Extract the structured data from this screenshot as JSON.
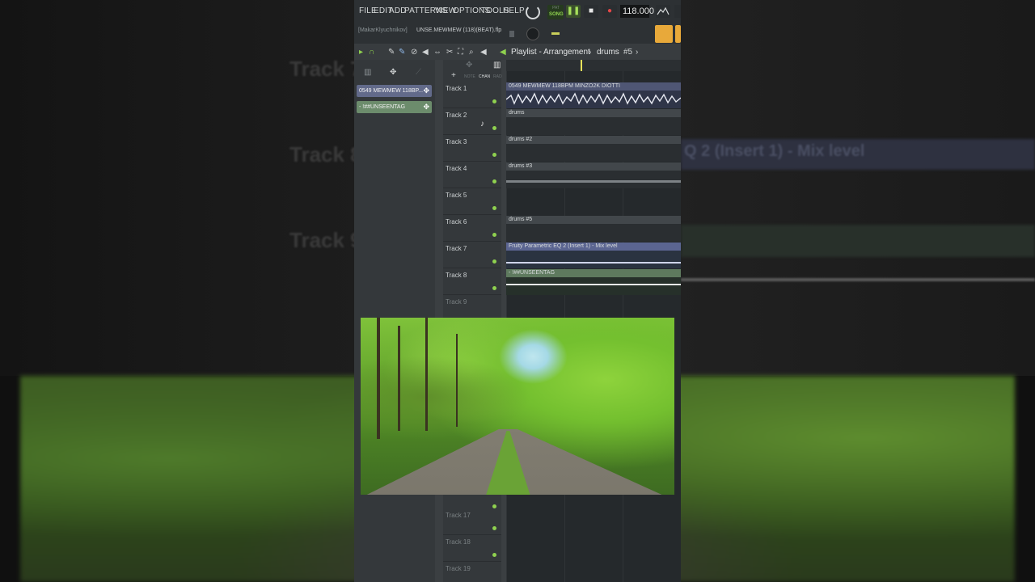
{
  "menu": [
    "FILE",
    "EDIT",
    "ADD",
    "PATTERNS",
    "VIEW",
    "OPTIONS",
    "TOOLS",
    "HELP"
  ],
  "transport": {
    "pat_label": "PAT",
    "song_label": "SONG",
    "pause": "❚❚",
    "stop": "■",
    "record": "●",
    "tempo": "118.000"
  },
  "project": {
    "user": "[MakarKlyuchnikov]",
    "file": "UNSE.MEWMEW (118)(BEAT).flp"
  },
  "playlist": {
    "title": "Playlist - Arrangement",
    "separator": "›",
    "pattern": "drums",
    "pattern_num": "#5",
    "arrow": "›"
  },
  "picker": {
    "audio_clip": "0549 MEWMEW 118BP...",
    "automation_clip": "- !##UNSEENTAG"
  },
  "ruler_labels": [
    "NOTE",
    "CHAN",
    "RAD"
  ],
  "tracks": [
    {
      "name": "Track 1",
      "visible": true
    },
    {
      "name": "Track 2",
      "visible": true
    },
    {
      "name": "Track 3",
      "visible": true
    },
    {
      "name": "Track 4",
      "visible": true
    },
    {
      "name": "Track 5",
      "visible": true
    },
    {
      "name": "Track 6",
      "visible": true
    },
    {
      "name": "Track 7",
      "visible": true
    },
    {
      "name": "Track 8",
      "visible": true
    },
    {
      "name": "Track 9",
      "visible": true
    },
    {
      "name": "Track 17",
      "visible": true
    },
    {
      "name": "Track 18",
      "visible": true
    },
    {
      "name": "Track 19",
      "visible": true
    }
  ],
  "clips": [
    {
      "track": 1,
      "label": "0549 MEWMEW 118BPM MINZO2K DIOTTI",
      "kind": "audio"
    },
    {
      "track": 2,
      "label": "drums",
      "kind": "pattern"
    },
    {
      "track": 3,
      "label": "drums #2",
      "kind": "pattern"
    },
    {
      "track": 4,
      "label": "drums #3",
      "kind": "pattern"
    },
    {
      "track": 6,
      "label": "drums #5",
      "kind": "pattern"
    },
    {
      "track": 7,
      "label": "Fruity Parametric EQ 2 (Insert 1) - Mix level",
      "kind": "automation"
    },
    {
      "track": 8,
      "label": "- !##UNSEENTAG",
      "kind": "automation2"
    }
  ],
  "background_ghosts": [
    "Track 7",
    "Track 8",
    "Track 9"
  ],
  "background_strip_text": "Q 2 (Insert 1) - Mix level",
  "colors": {
    "accent_green": "#8fd14f",
    "audio_clip": "#4f5674",
    "automation_clip": "#5b6591",
    "ruler_red": "#c45a5a",
    "orange_btn": "#e8a93a"
  }
}
